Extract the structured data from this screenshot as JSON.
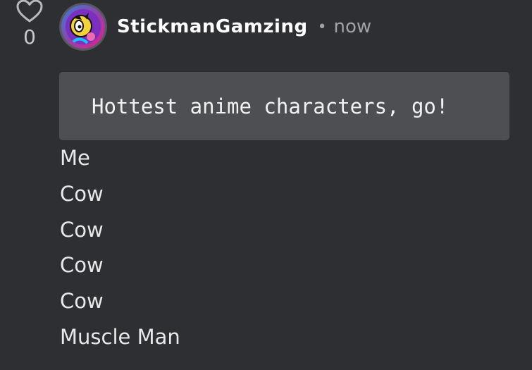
{
  "like": {
    "count": "0"
  },
  "post": {
    "username": "StickmanGamzing",
    "separator": "•",
    "time": "now",
    "code": "Hottest anime characters, go!",
    "lines": [
      "Me",
      "Cow",
      "Cow",
      "Cow",
      "Cow",
      "Muscle Man"
    ]
  },
  "colors": {
    "background": "#2e2f33",
    "code_background": "#4e4f53",
    "muted_text": "#a2a2a6"
  },
  "icons": {
    "like": "heart-outline-icon",
    "avatar": "character-avatar"
  }
}
